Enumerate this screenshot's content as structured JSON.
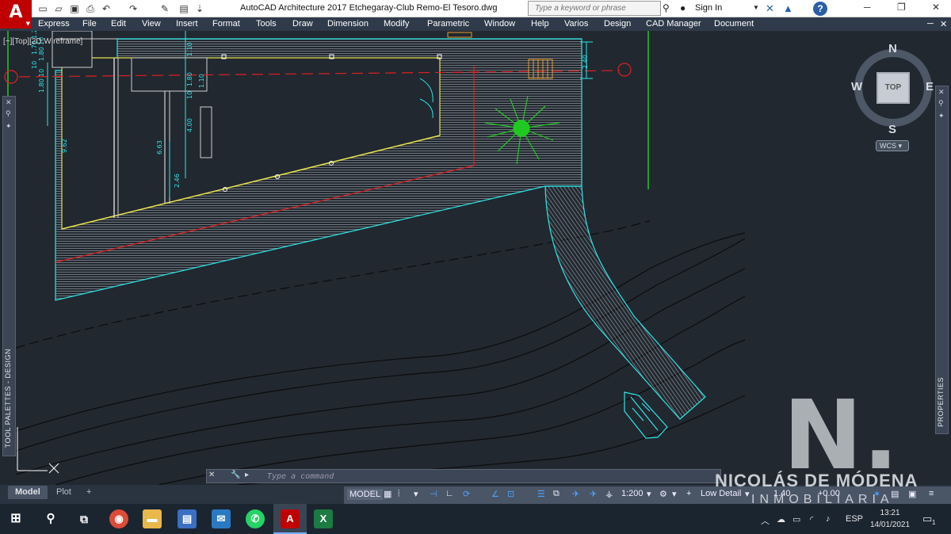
{
  "title_bar": {
    "app_letter": "A",
    "title": "AutoCAD Architecture 2017    Etchegaray-Club Remo-El Tesoro.dwg",
    "search_placeholder": "Type a keyword or phrase",
    "sign_in": "Sign In",
    "help": "?"
  },
  "menu": {
    "items": [
      "Express",
      "File",
      "Edit",
      "View",
      "Insert",
      "Format",
      "Tools",
      "Draw",
      "Dimension",
      "Modify",
      "Parametric",
      "Window",
      "Help",
      "Varios",
      "Design",
      "CAD Manager",
      "Document"
    ]
  },
  "viewport": {
    "label": "[−][Top][2D Wireframe]"
  },
  "dimensions": {
    "d1": "10",
    "d2": "1.70",
    "d3": "1.2",
    "d4": "1.80",
    "d5": "10",
    "d6": "1.10",
    "d7": "1.80",
    "d8": "1.10",
    "d9": "4.00",
    "d10": "6.63",
    "d11": "2.46",
    "d12": "9.62",
    "d13": "2.40",
    "d14": "10",
    "d15": "1.80",
    "d16": "10"
  },
  "view_cube": {
    "top": "TOP",
    "north": "N",
    "south": "S",
    "east": "E",
    "west": "W",
    "wcs": "WCS"
  },
  "palettes": {
    "left": "TOOL PALETTES - DESIGN",
    "right": "PROPERTIES"
  },
  "watermark": {
    "letter": "N.",
    "name": "NICOLÁS DE MÓDENA",
    "sub": "INMOBILIARIA"
  },
  "command_line": {
    "placeholder": "Type a command"
  },
  "layout_tabs": {
    "model": "Model",
    "plot": "Plot",
    "add": "+"
  },
  "status_bar": {
    "model": "MODEL",
    "scale": "1:200",
    "detail": "Low Detail",
    "elev1": "1.40",
    "elev2": "+0.00"
  },
  "taskbar": {
    "lang": "ESP",
    "time": "13:21",
    "date": "14/01/2021",
    "notifications": "1"
  },
  "colors": {
    "canvas": "#212830",
    "cyan": "#2ee6e6",
    "yellow": "#e8e04a",
    "red": "#e02020",
    "green": "#22c822",
    "menubar": "#2f3a4a"
  }
}
